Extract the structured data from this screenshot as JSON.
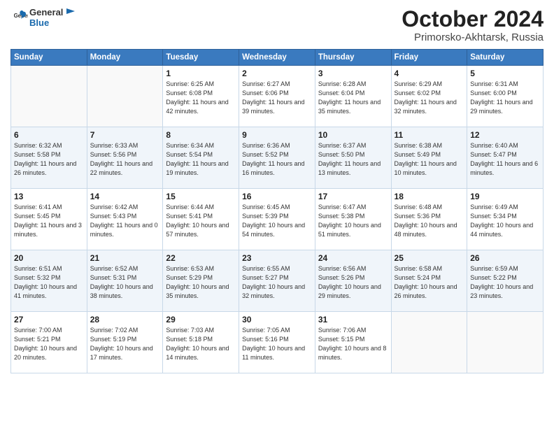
{
  "header": {
    "logo_general": "General",
    "logo_blue": "Blue",
    "title": "October 2024",
    "location": "Primorsko-Akhtarsk, Russia"
  },
  "weekdays": [
    "Sunday",
    "Monday",
    "Tuesday",
    "Wednesday",
    "Thursday",
    "Friday",
    "Saturday"
  ],
  "weeks": [
    [
      {
        "day": "",
        "sunrise": "",
        "sunset": "",
        "daylight": ""
      },
      {
        "day": "",
        "sunrise": "",
        "sunset": "",
        "daylight": ""
      },
      {
        "day": "1",
        "sunrise": "Sunrise: 6:25 AM",
        "sunset": "Sunset: 6:08 PM",
        "daylight": "Daylight: 11 hours and 42 minutes."
      },
      {
        "day": "2",
        "sunrise": "Sunrise: 6:27 AM",
        "sunset": "Sunset: 6:06 PM",
        "daylight": "Daylight: 11 hours and 39 minutes."
      },
      {
        "day": "3",
        "sunrise": "Sunrise: 6:28 AM",
        "sunset": "Sunset: 6:04 PM",
        "daylight": "Daylight: 11 hours and 35 minutes."
      },
      {
        "day": "4",
        "sunrise": "Sunrise: 6:29 AM",
        "sunset": "Sunset: 6:02 PM",
        "daylight": "Daylight: 11 hours and 32 minutes."
      },
      {
        "day": "5",
        "sunrise": "Sunrise: 6:31 AM",
        "sunset": "Sunset: 6:00 PM",
        "daylight": "Daylight: 11 hours and 29 minutes."
      }
    ],
    [
      {
        "day": "6",
        "sunrise": "Sunrise: 6:32 AM",
        "sunset": "Sunset: 5:58 PM",
        "daylight": "Daylight: 11 hours and 26 minutes."
      },
      {
        "day": "7",
        "sunrise": "Sunrise: 6:33 AM",
        "sunset": "Sunset: 5:56 PM",
        "daylight": "Daylight: 11 hours and 22 minutes."
      },
      {
        "day": "8",
        "sunrise": "Sunrise: 6:34 AM",
        "sunset": "Sunset: 5:54 PM",
        "daylight": "Daylight: 11 hours and 19 minutes."
      },
      {
        "day": "9",
        "sunrise": "Sunrise: 6:36 AM",
        "sunset": "Sunset: 5:52 PM",
        "daylight": "Daylight: 11 hours and 16 minutes."
      },
      {
        "day": "10",
        "sunrise": "Sunrise: 6:37 AM",
        "sunset": "Sunset: 5:50 PM",
        "daylight": "Daylight: 11 hours and 13 minutes."
      },
      {
        "day": "11",
        "sunrise": "Sunrise: 6:38 AM",
        "sunset": "Sunset: 5:49 PM",
        "daylight": "Daylight: 11 hours and 10 minutes."
      },
      {
        "day": "12",
        "sunrise": "Sunrise: 6:40 AM",
        "sunset": "Sunset: 5:47 PM",
        "daylight": "Daylight: 11 hours and 6 minutes."
      }
    ],
    [
      {
        "day": "13",
        "sunrise": "Sunrise: 6:41 AM",
        "sunset": "Sunset: 5:45 PM",
        "daylight": "Daylight: 11 hours and 3 minutes."
      },
      {
        "day": "14",
        "sunrise": "Sunrise: 6:42 AM",
        "sunset": "Sunset: 5:43 PM",
        "daylight": "Daylight: 11 hours and 0 minutes."
      },
      {
        "day": "15",
        "sunrise": "Sunrise: 6:44 AM",
        "sunset": "Sunset: 5:41 PM",
        "daylight": "Daylight: 10 hours and 57 minutes."
      },
      {
        "day": "16",
        "sunrise": "Sunrise: 6:45 AM",
        "sunset": "Sunset: 5:39 PM",
        "daylight": "Daylight: 10 hours and 54 minutes."
      },
      {
        "day": "17",
        "sunrise": "Sunrise: 6:47 AM",
        "sunset": "Sunset: 5:38 PM",
        "daylight": "Daylight: 10 hours and 51 minutes."
      },
      {
        "day": "18",
        "sunrise": "Sunrise: 6:48 AM",
        "sunset": "Sunset: 5:36 PM",
        "daylight": "Daylight: 10 hours and 48 minutes."
      },
      {
        "day": "19",
        "sunrise": "Sunrise: 6:49 AM",
        "sunset": "Sunset: 5:34 PM",
        "daylight": "Daylight: 10 hours and 44 minutes."
      }
    ],
    [
      {
        "day": "20",
        "sunrise": "Sunrise: 6:51 AM",
        "sunset": "Sunset: 5:32 PM",
        "daylight": "Daylight: 10 hours and 41 minutes."
      },
      {
        "day": "21",
        "sunrise": "Sunrise: 6:52 AM",
        "sunset": "Sunset: 5:31 PM",
        "daylight": "Daylight: 10 hours and 38 minutes."
      },
      {
        "day": "22",
        "sunrise": "Sunrise: 6:53 AM",
        "sunset": "Sunset: 5:29 PM",
        "daylight": "Daylight: 10 hours and 35 minutes."
      },
      {
        "day": "23",
        "sunrise": "Sunrise: 6:55 AM",
        "sunset": "Sunset: 5:27 PM",
        "daylight": "Daylight: 10 hours and 32 minutes."
      },
      {
        "day": "24",
        "sunrise": "Sunrise: 6:56 AM",
        "sunset": "Sunset: 5:26 PM",
        "daylight": "Daylight: 10 hours and 29 minutes."
      },
      {
        "day": "25",
        "sunrise": "Sunrise: 6:58 AM",
        "sunset": "Sunset: 5:24 PM",
        "daylight": "Daylight: 10 hours and 26 minutes."
      },
      {
        "day": "26",
        "sunrise": "Sunrise: 6:59 AM",
        "sunset": "Sunset: 5:22 PM",
        "daylight": "Daylight: 10 hours and 23 minutes."
      }
    ],
    [
      {
        "day": "27",
        "sunrise": "Sunrise: 7:00 AM",
        "sunset": "Sunset: 5:21 PM",
        "daylight": "Daylight: 10 hours and 20 minutes."
      },
      {
        "day": "28",
        "sunrise": "Sunrise: 7:02 AM",
        "sunset": "Sunset: 5:19 PM",
        "daylight": "Daylight: 10 hours and 17 minutes."
      },
      {
        "day": "29",
        "sunrise": "Sunrise: 7:03 AM",
        "sunset": "Sunset: 5:18 PM",
        "daylight": "Daylight: 10 hours and 14 minutes."
      },
      {
        "day": "30",
        "sunrise": "Sunrise: 7:05 AM",
        "sunset": "Sunset: 5:16 PM",
        "daylight": "Daylight: 10 hours and 11 minutes."
      },
      {
        "day": "31",
        "sunrise": "Sunrise: 7:06 AM",
        "sunset": "Sunset: 5:15 PM",
        "daylight": "Daylight: 10 hours and 8 minutes."
      },
      {
        "day": "",
        "sunrise": "",
        "sunset": "",
        "daylight": ""
      },
      {
        "day": "",
        "sunrise": "",
        "sunset": "",
        "daylight": ""
      }
    ]
  ]
}
